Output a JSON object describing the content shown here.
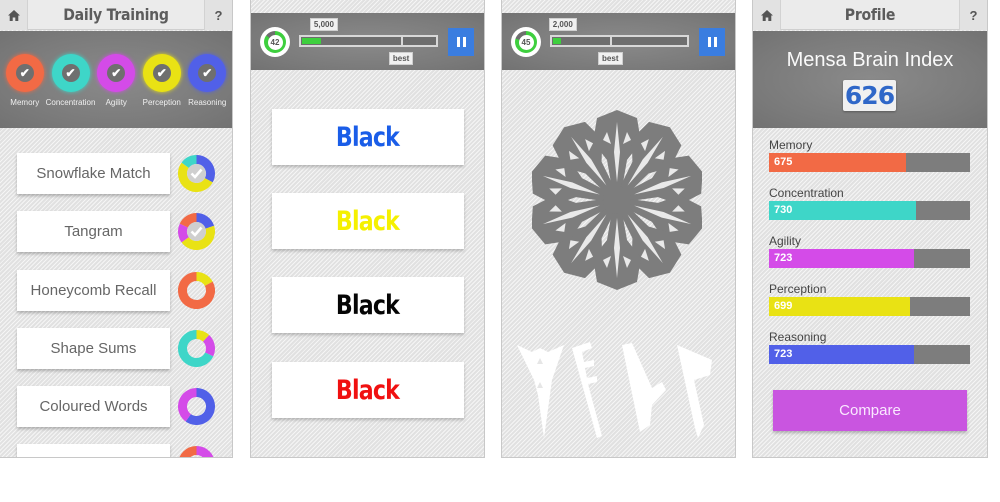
{
  "screens": {
    "daily_training": {
      "title": "Daily Training",
      "home_icon": "home-icon",
      "help_label": "?",
      "categories": [
        {
          "label": "Memory",
          "color": "#f26a45",
          "completed": true
        },
        {
          "label": "Concentration",
          "color": "#3ed6c8",
          "completed": true
        },
        {
          "label": "Agility",
          "color": "#d44be8",
          "completed": true
        },
        {
          "label": "Perception",
          "color": "#e9e214",
          "completed": true
        },
        {
          "label": "Reasoning",
          "color": "#5160e8",
          "completed": true
        }
      ],
      "check_glyph": "✔",
      "games": [
        {
          "label": "Snowflake Match",
          "completed": true,
          "segments": [
            {
              "color": "#5160e8",
              "share": 0.33
            },
            {
              "color": "#e9e214",
              "share": 0.52
            },
            {
              "color": "#3ed6c8",
              "share": 0.15
            }
          ]
        },
        {
          "label": "Tangram",
          "completed": true,
          "segments": [
            {
              "color": "#5160e8",
              "share": 0.2
            },
            {
              "color": "#e9e214",
              "share": 0.45
            },
            {
              "color": "#d44be8",
              "share": 0.17
            },
            {
              "color": "#f26a45",
              "share": 0.18
            }
          ]
        },
        {
          "label": "Honeycomb Recall",
          "completed": false,
          "segments": [
            {
              "color": "#e9e214",
              "share": 0.17
            },
            {
              "color": "#f26a45",
              "share": 0.83
            }
          ]
        },
        {
          "label": "Shape Sums",
          "completed": false,
          "segments": [
            {
              "color": "#e9e214",
              "share": 0.12
            },
            {
              "color": "#d44be8",
              "share": 0.2
            },
            {
              "color": "#3ed6c8",
              "share": 0.68
            }
          ]
        },
        {
          "label": "Coloured Words",
          "completed": false,
          "segments": [
            {
              "color": "#5160e8",
              "share": 0.6
            },
            {
              "color": "#d44be8",
              "share": 0.4
            }
          ]
        },
        {
          "label": "",
          "completed": false,
          "segments": [
            {
              "color": "#d44be8",
              "share": 0.5
            },
            {
              "color": "#f26a45",
              "share": 0.5
            }
          ]
        }
      ]
    },
    "coloured_words": {
      "timer": "42",
      "timer_progress": 0.85,
      "score_label": "5,000",
      "score_progress": 0.14,
      "best_label": "best",
      "best_position": 0.74,
      "pause_icon": "pause-icon",
      "options": [
        {
          "word": "Black",
          "color": "#1a5de8"
        },
        {
          "word": "Black",
          "color": "#f5f000"
        },
        {
          "word": "Black",
          "color": "#050505"
        },
        {
          "word": "Black",
          "color": "#f01010"
        }
      ]
    },
    "snowflake_match": {
      "timer": "45",
      "timer_progress": 0.8,
      "score_label": "2,000",
      "score_progress": 0.05,
      "best_label": "best",
      "best_position": 0.43,
      "pause_icon": "pause-icon",
      "target": "snowflake-icon",
      "pieces": [
        "piece-arrow-icon",
        "piece-comb-icon",
        "piece-hook-icon",
        "piece-flag-icon"
      ]
    },
    "profile": {
      "title": "Profile",
      "home_icon": "home-icon",
      "help_label": "?",
      "index_title": "Mensa Brain Index",
      "index_score": "626",
      "stats": [
        {
          "label": "Memory",
          "value": "675",
          "fraction": 0.68,
          "color": "#f26a45"
        },
        {
          "label": "Concentration",
          "value": "730",
          "fraction": 0.73,
          "color": "#3ed6c8"
        },
        {
          "label": "Agility",
          "value": "723",
          "fraction": 0.72,
          "color": "#d44be8"
        },
        {
          "label": "Perception",
          "value": "699",
          "fraction": 0.7,
          "color": "#e9e214"
        },
        {
          "label": "Reasoning",
          "value": "723",
          "fraction": 0.72,
          "color": "#5160e8"
        }
      ],
      "compare_label": "Compare"
    }
  }
}
